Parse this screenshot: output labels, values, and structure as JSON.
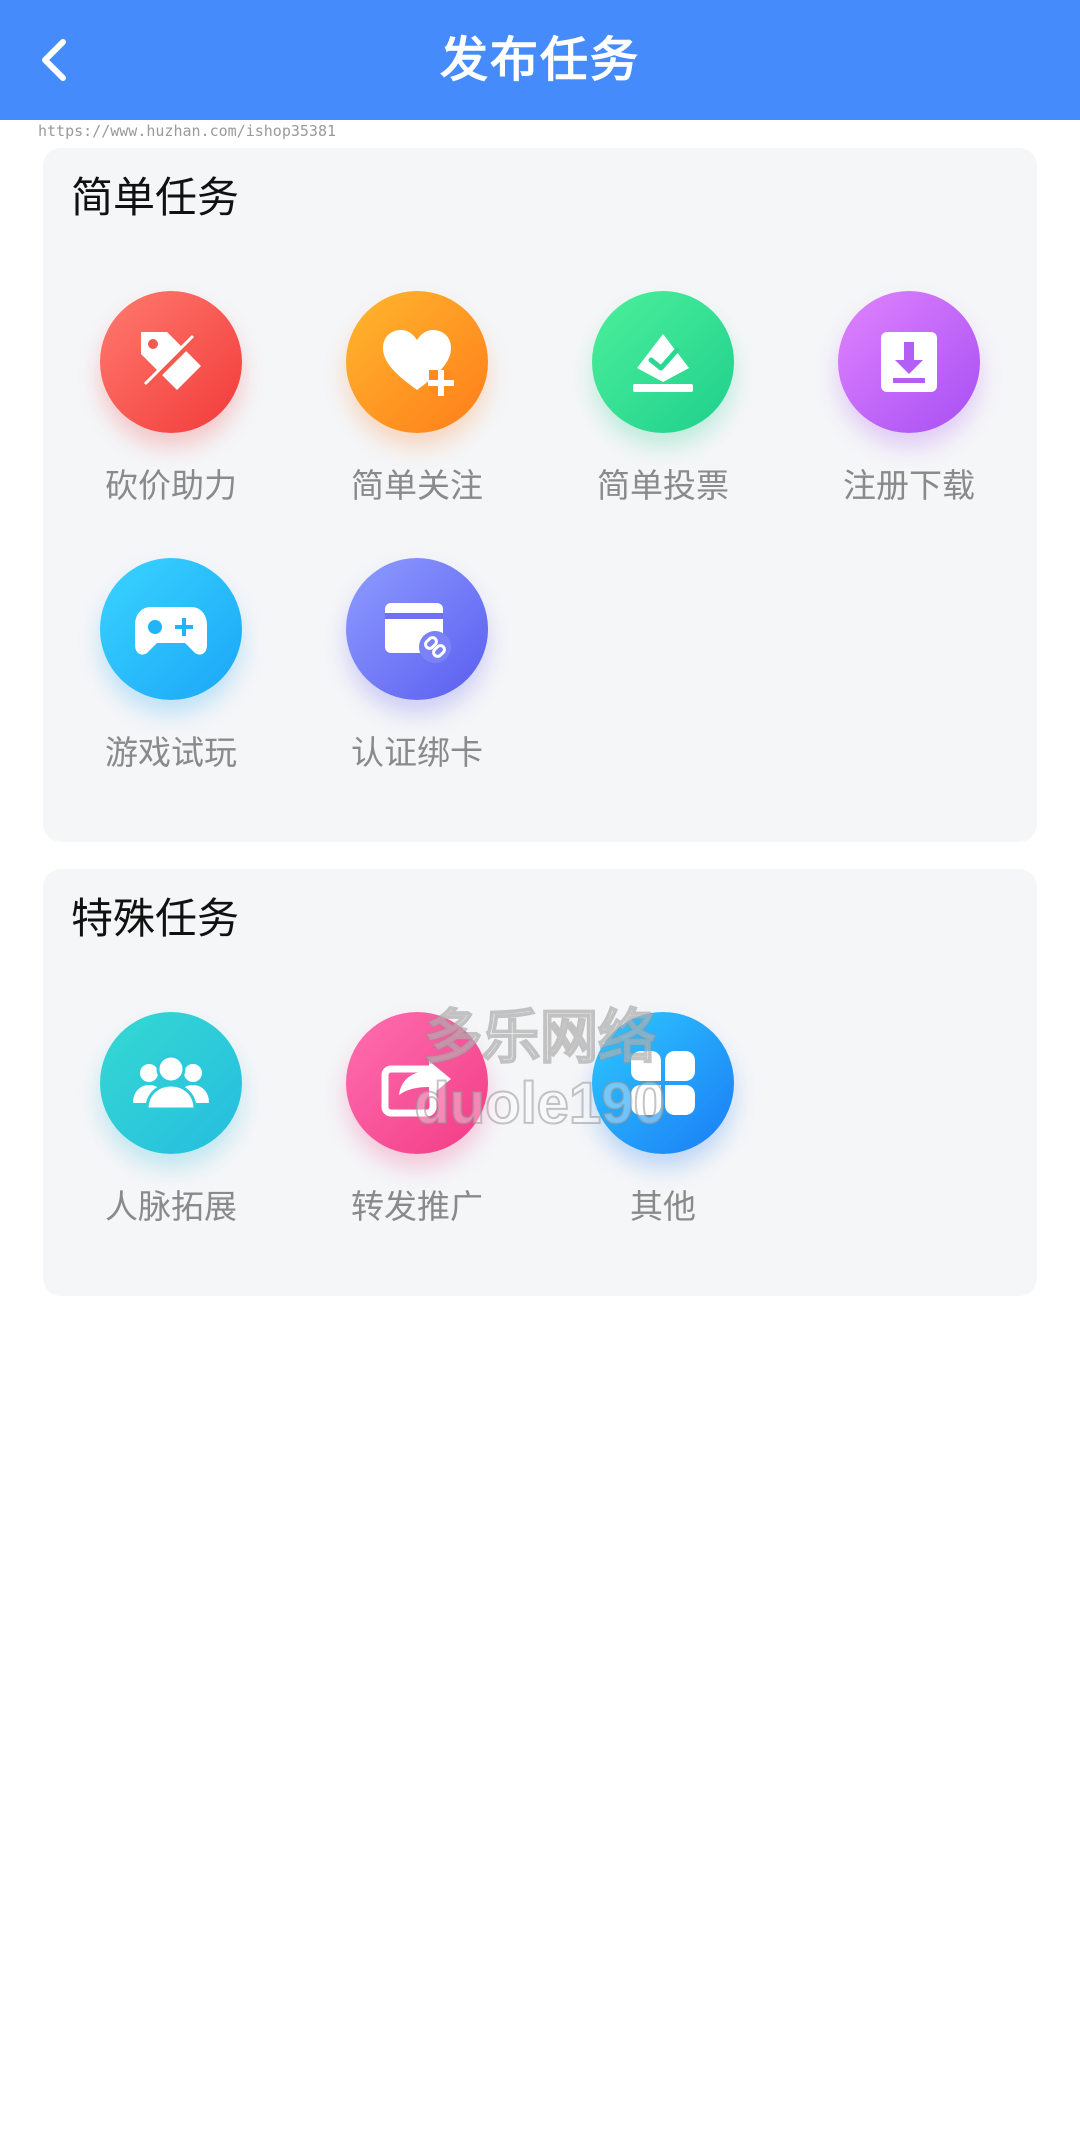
{
  "header": {
    "title": "发布任务"
  },
  "url_watermark": "https://www.huzhan.com/ishop35381",
  "simple_section": {
    "title": "简单任务",
    "items": [
      {
        "label": "砍价助力",
        "icon": "price-tag-icon"
      },
      {
        "label": "简单关注",
        "icon": "heart-plus-icon"
      },
      {
        "label": "简单投票",
        "icon": "vote-ballot-icon"
      },
      {
        "label": "注册下载",
        "icon": "download-icon"
      },
      {
        "label": "游戏试玩",
        "icon": "gamepad-icon"
      },
      {
        "label": "认证绑卡",
        "icon": "card-link-icon"
      }
    ]
  },
  "special_section": {
    "title": "特殊任务",
    "items": [
      {
        "label": "人脉拓展",
        "icon": "users-icon"
      },
      {
        "label": "转发推广",
        "icon": "share-forward-icon"
      },
      {
        "label": "其他",
        "icon": "clover-icon"
      }
    ]
  },
  "watermark": {
    "line1": "多乐网络",
    "line2": "duole190"
  }
}
